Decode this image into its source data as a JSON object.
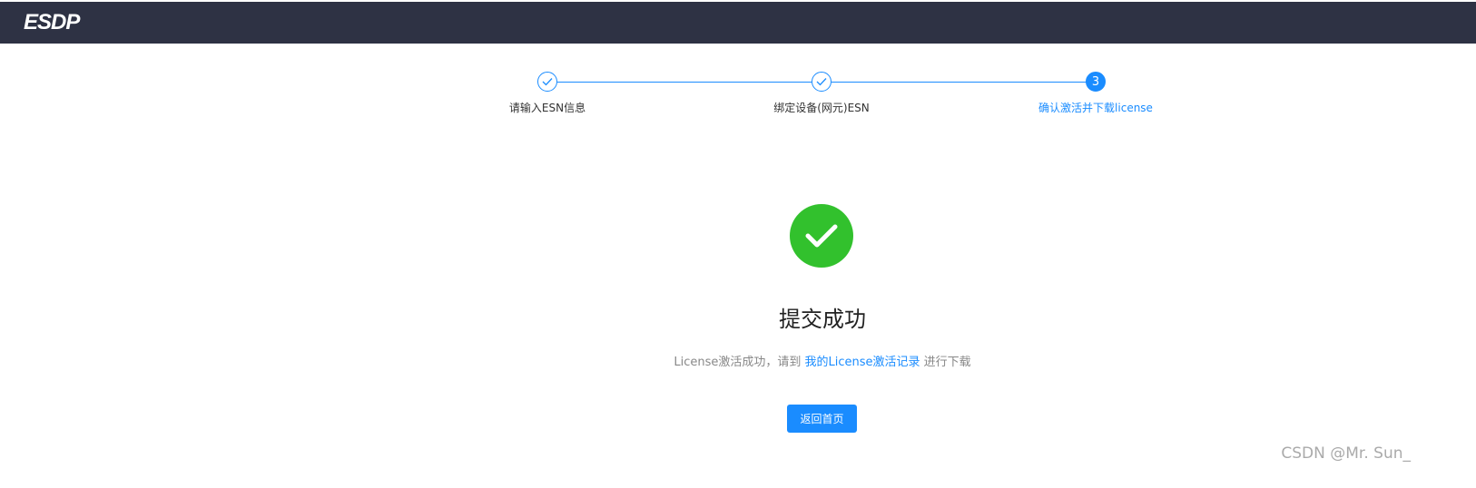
{
  "header": {
    "logo": "ESDP"
  },
  "steps": [
    {
      "label": "请输入ESN信息",
      "status": "done"
    },
    {
      "label": "绑定设备(网元)ESN",
      "status": "done"
    },
    {
      "label": "确认激活并下载license",
      "status": "current",
      "number": "3"
    }
  ],
  "result": {
    "title": "提交成功",
    "desc_prefix": "License激活成功，请到 ",
    "desc_link": "我的License激活记录",
    "desc_suffix": " 进行下载",
    "button_label": "返回首页"
  },
  "watermark": "CSDN @Mr. Sun_",
  "colors": {
    "primary": "#1a8cff",
    "success": "#32c12d",
    "header_bg": "#2e3244"
  }
}
